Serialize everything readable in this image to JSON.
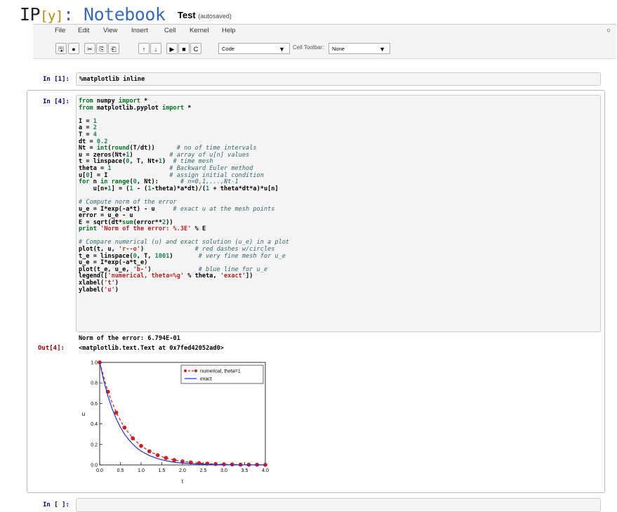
{
  "header": {
    "logo_ip": "IP",
    "logo_bracket": "[y]",
    "logo_rest": ": Notebook",
    "notebook_name": "Test",
    "save_status": "(autosaved)"
  },
  "menu": [
    "File",
    "Edit",
    "View",
    "Insert",
    "Cell",
    "Kernel",
    "Help"
  ],
  "kernel_indicator": "○",
  "toolbar": {
    "buttons": [
      "🖫",
      "●",
      "✂",
      "⎘",
      "⎗",
      "↑",
      "↓",
      "▶",
      "■",
      "C"
    ],
    "cell_type_value": "Code",
    "cell_toolbar_label": "Cell Toolbar:",
    "cell_toolbar_value": "None",
    "dropdown_arrow": "▼"
  },
  "cells": {
    "cell1": {
      "prompt": "In [1]:",
      "source": "%matplotlib inline"
    },
    "cell2": {
      "prompt": "In [4]:",
      "stdout": "Norm of the error: 6.794E-01",
      "out_prompt": "Out[4]:",
      "out_repr": "<matplotlib.text.Text at 0x7fed42052ad0>"
    },
    "cell3": {
      "prompt": "In [ ]:"
    }
  },
  "chart_data": {
    "type": "line",
    "title": "",
    "xlabel": "t",
    "ylabel": "u",
    "xlim": [
      0,
      4
    ],
    "ylim": [
      0,
      1
    ],
    "xticks": [
      "0.0",
      "0.5",
      "1.0",
      "1.5",
      "2.0",
      "2.5",
      "3.0",
      "3.5",
      "4.0"
    ],
    "yticks": [
      "0.0",
      "0.2",
      "0.4",
      "0.6",
      "0.8",
      "1.0"
    ],
    "legend_position": "top-right",
    "series": [
      {
        "name": "numerical, theta=1",
        "style": "r--o",
        "color": "#cc2222",
        "x": [
          0,
          0.2,
          0.4,
          0.6,
          0.8,
          1.0,
          1.2,
          1.4,
          1.6,
          1.8,
          2.0,
          2.2,
          2.4,
          2.6,
          2.8,
          3.0,
          3.2,
          3.4,
          3.6,
          3.8,
          4.0
        ],
        "y": [
          1.0,
          0.714,
          0.51,
          0.364,
          0.26,
          0.186,
          0.133,
          0.095,
          0.068,
          0.048,
          0.035,
          0.025,
          0.018,
          0.013,
          0.009,
          0.006,
          0.005,
          0.003,
          0.002,
          0.002,
          0.001
        ]
      },
      {
        "name": "exact",
        "style": "b-",
        "color": "#2233cc",
        "x": [
          0,
          0.1,
          0.2,
          0.3,
          0.4,
          0.5,
          0.6,
          0.7,
          0.8,
          0.9,
          1.0,
          1.2,
          1.4,
          1.6,
          1.8,
          2.0,
          2.3,
          2.6,
          3.0,
          3.5,
          4.0
        ],
        "y": [
          1.0,
          0.819,
          0.67,
          0.549,
          0.449,
          0.368,
          0.301,
          0.247,
          0.202,
          0.165,
          0.135,
          0.091,
          0.061,
          0.041,
          0.027,
          0.018,
          0.01,
          0.006,
          0.002,
          0.001,
          0.0
        ]
      }
    ]
  }
}
